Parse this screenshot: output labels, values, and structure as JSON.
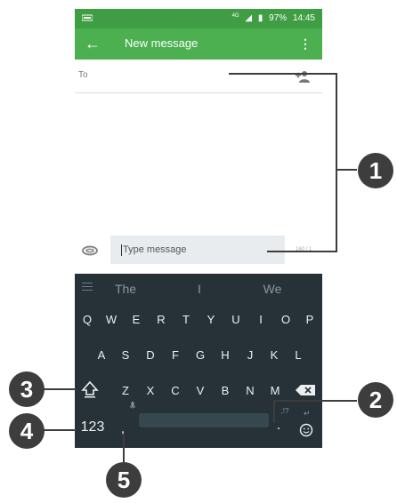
{
  "status_bar": {
    "network": "4G",
    "battery": "97%",
    "time": "14:45"
  },
  "app_bar": {
    "title": "New message"
  },
  "compose": {
    "to_label": "To",
    "message_placeholder": "Type message",
    "char_count": "160 / 1"
  },
  "keyboard": {
    "suggestions": [
      "The",
      "I",
      "We"
    ],
    "row1": [
      "Q",
      "W",
      "E",
      "R",
      "T",
      "Y",
      "U",
      "I",
      "O",
      "P"
    ],
    "row2": [
      "A",
      "S",
      "D",
      "F",
      "G",
      "H",
      "J",
      "K",
      "L"
    ],
    "row3": [
      "Z",
      "X",
      "C",
      "V",
      "B",
      "N",
      "M"
    ],
    "numbers_key": "123",
    "comma_key": ",",
    "period_key": ".",
    "punct_hint": ",!?"
  },
  "callouts": [
    "1",
    "2",
    "3",
    "4",
    "5"
  ]
}
